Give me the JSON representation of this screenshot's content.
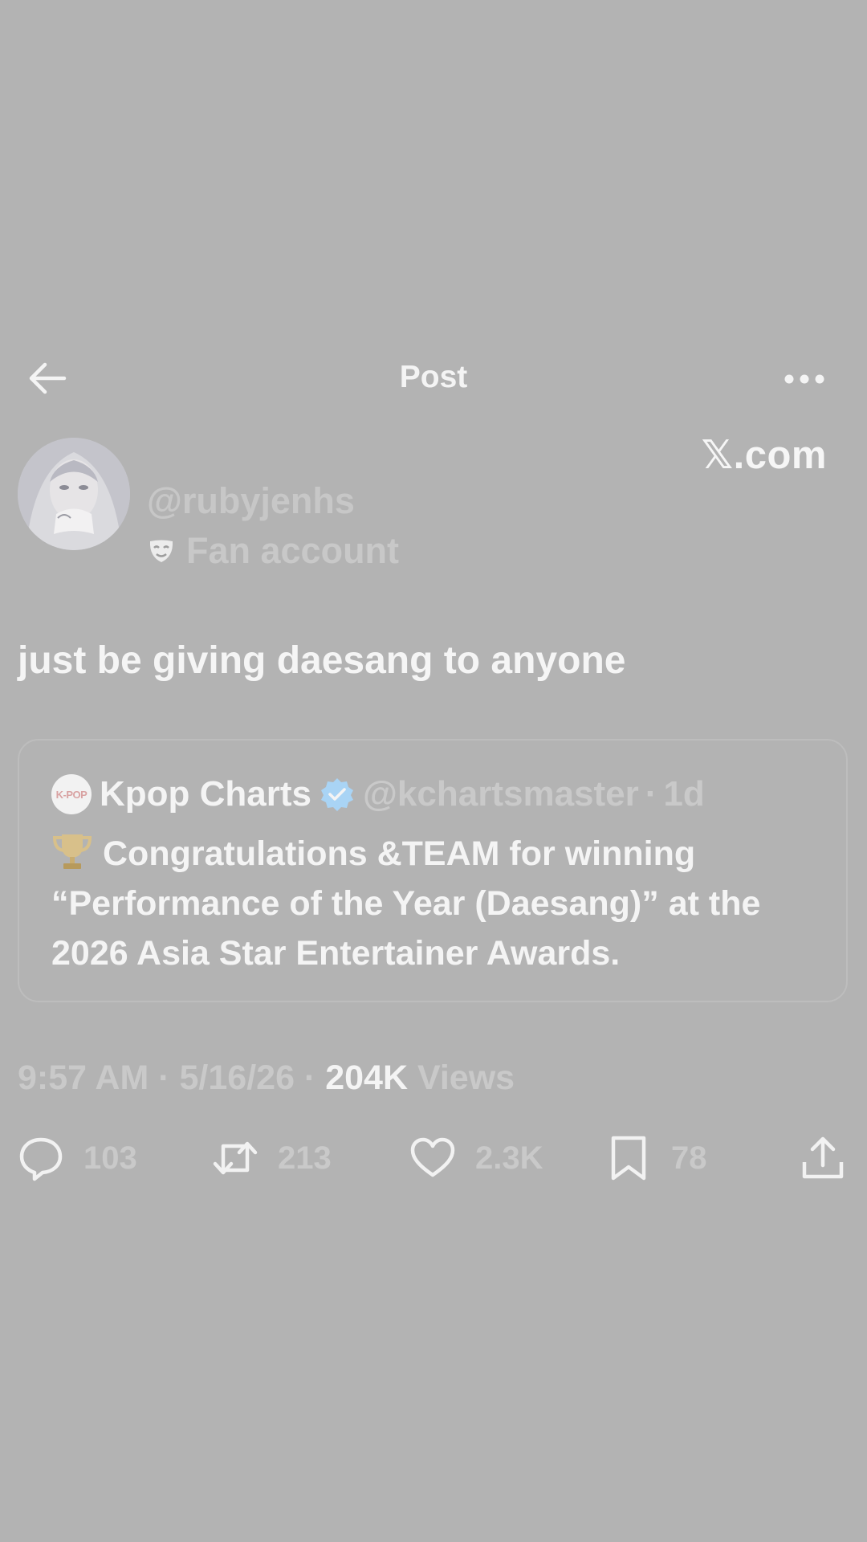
{
  "header": {
    "title": "Post",
    "back_icon": "arrow-left-icon",
    "more_icon": "more-horizontal-icon"
  },
  "watermark": "𝕏.com",
  "author": {
    "handle": "@rubyjenhs",
    "label": "Fan account",
    "label_icon": "mask-icon"
  },
  "tweet": {
    "text": "just be giving daesang to anyone"
  },
  "quote": {
    "avatar_text": "K-POP",
    "name": "Kpop Charts",
    "verified_icon": "verified-badge-icon",
    "handle": "@kchartsmaster",
    "separator": "·",
    "time": "1d",
    "body": "Congratulations &TEAM for winning “Performance of the Year (Daesang)” at the 2026 Asia Star Entertainer Awards."
  },
  "meta": {
    "time": "9:57 AM",
    "sep1": " · ",
    "date": "5/16/26",
    "sep2": " · ",
    "views_count": "204K",
    "views_label": " Views"
  },
  "actions": {
    "replies": "103",
    "reposts": "213",
    "likes": "2.3K",
    "bookmarks": "78"
  },
  "colors": {
    "background": "#b3b3b3",
    "text_primary": "#f4f4f4",
    "text_secondary": "#c9c9c9",
    "verified": "#a9d4f5"
  }
}
